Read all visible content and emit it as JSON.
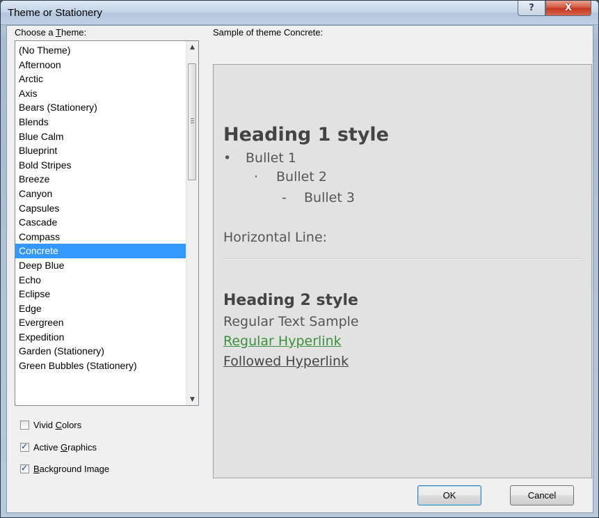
{
  "window": {
    "title": "Theme or Stationery",
    "help_glyph": "?",
    "close_glyph": "X"
  },
  "left": {
    "choose_label_pre": "Choose a ",
    "choose_label_accel": "T",
    "choose_label_post": "heme:",
    "items": [
      "(No Theme)",
      "Afternoon",
      "Arctic",
      "Axis",
      "Bears (Stationery)",
      "Blends",
      "Blue Calm",
      "Blueprint",
      "Bold Stripes",
      "Breeze",
      "Canyon",
      "Capsules",
      "Cascade",
      "Compass",
      "Concrete",
      "Deep Blue",
      "Echo",
      "Eclipse",
      "Edge",
      "Evergreen",
      "Expedition",
      "Garden (Stationery)",
      "Green Bubbles (Stationery)"
    ],
    "selected": "Concrete"
  },
  "options": {
    "vivid": {
      "pre": "Vivid ",
      "accel": "C",
      "post": "olors",
      "checked": false
    },
    "active": {
      "pre": "Active ",
      "accel": "G",
      "post": "raphics",
      "checked": true
    },
    "background": {
      "pre": "",
      "accel": "B",
      "post": "ackground Image",
      "checked": true
    }
  },
  "preview": {
    "label": "Sample of theme Concrete:",
    "heading1": "Heading 1 style",
    "bullet1_mark": "•",
    "bullet1": "Bullet 1",
    "bullet2_mark": "·",
    "bullet2": "Bullet 2",
    "bullet3_mark": "-",
    "bullet3": "Bullet 3",
    "horizontal_line_label": "Horizontal Line:",
    "heading2": "Heading 2 style",
    "regular_text": "Regular Text Sample",
    "regular_hyperlink": "Regular Hyperlink",
    "followed_hyperlink": "Followed Hyperlink"
  },
  "buttons": {
    "ok": "OK",
    "cancel": "Cancel"
  },
  "colors": {
    "selection": "#3399ff",
    "hyperlink": "#3c8f3c",
    "close": "#c4371d"
  }
}
